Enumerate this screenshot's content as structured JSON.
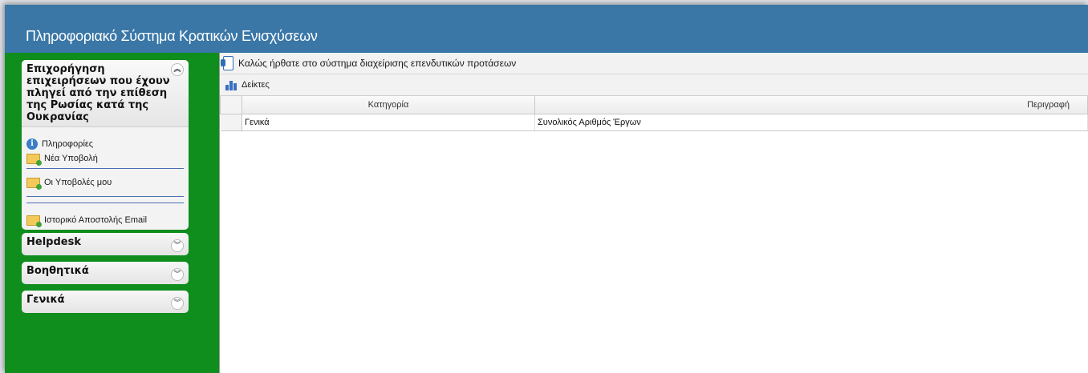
{
  "header": {
    "title": "Πληροφοριακό Σύστημα Κρατικών Ενισχύσεων"
  },
  "sidebar": {
    "main_panel": {
      "title": "Επιχορήγηση επιχειρήσεων που έχουν πληγεί από την επίθεση της Ρωσίας κατά της Ουκρανίας",
      "items": {
        "info": "Πληροφορίες",
        "new_submission": "Νέα Υποβολή",
        "my_submissions": "Οι Υποβολές μου",
        "email_history": "Ιστορικό Αποστολής Email"
      }
    },
    "helpdesk": "Helpdesk",
    "aids": "Βοηθητικά",
    "general": "Γενικά"
  },
  "main": {
    "welcome": "Καλώς ήρθατε στο σύστημα διαχείρισης επενδυτικών προτάσεων",
    "toolbar_label": "Δείκτες",
    "table": {
      "col_category": "Κατηγορία",
      "col_description": "Περιγραφή",
      "rows": [
        {
          "category": "Γενικά",
          "description": "Συνολικός Αριθμός Έργων"
        }
      ]
    }
  },
  "colors": {
    "header": "#3a77a7",
    "sidebar": "#0f8d1d"
  }
}
